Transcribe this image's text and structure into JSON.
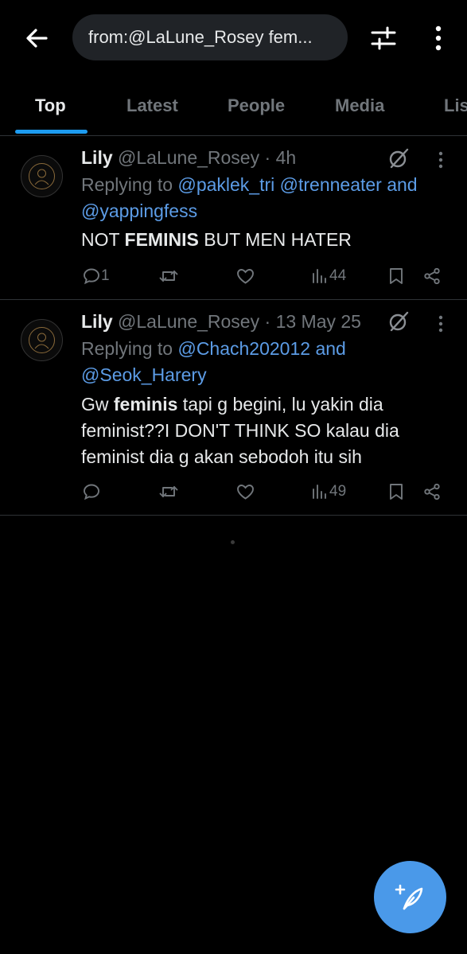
{
  "search": {
    "query": "from:@LaLune_Rosey fem..."
  },
  "tabs": [
    {
      "label": "Top"
    },
    {
      "label": "Latest"
    },
    {
      "label": "People"
    },
    {
      "label": "Media"
    },
    {
      "label": "Lis"
    }
  ],
  "posts": [
    {
      "name": "Lily",
      "handle": "@LaLune_Rosey",
      "sep": "·",
      "time": "4h",
      "replying_prefix": "Replying to",
      "replying_to_1": "@paklek_tri @trenneater and",
      "replying_to_2": "@yappingfess",
      "body_pre": "NOT ",
      "body_bold": "FEMINIS",
      "body_post": " BUT MEN HATER",
      "replies": "1",
      "views": "44"
    },
    {
      "name": "Lily",
      "handle": "@LaLune_Rosey",
      "sep": "·",
      "time": "13 May 25",
      "replying_prefix": "Replying to",
      "replying_to_1": "@Chach202012 and",
      "replying_to_2": "@Seok_Harery",
      "body_line1_pre": "Gw ",
      "body_line1_bold": "feminis",
      "body_line1_post": " tapi g begini, lu yakin dia",
      "body_line2": "feminist??I DON'T THINK SO kalau dia",
      "body_line3": "feminist dia g akan sebodoh itu sih",
      "replies": "",
      "views": "49"
    }
  ],
  "colors": {
    "accent": "#1d9bf0",
    "fab": "#4a99e9",
    "link": "#5c9ce6",
    "muted": "#71767b"
  }
}
